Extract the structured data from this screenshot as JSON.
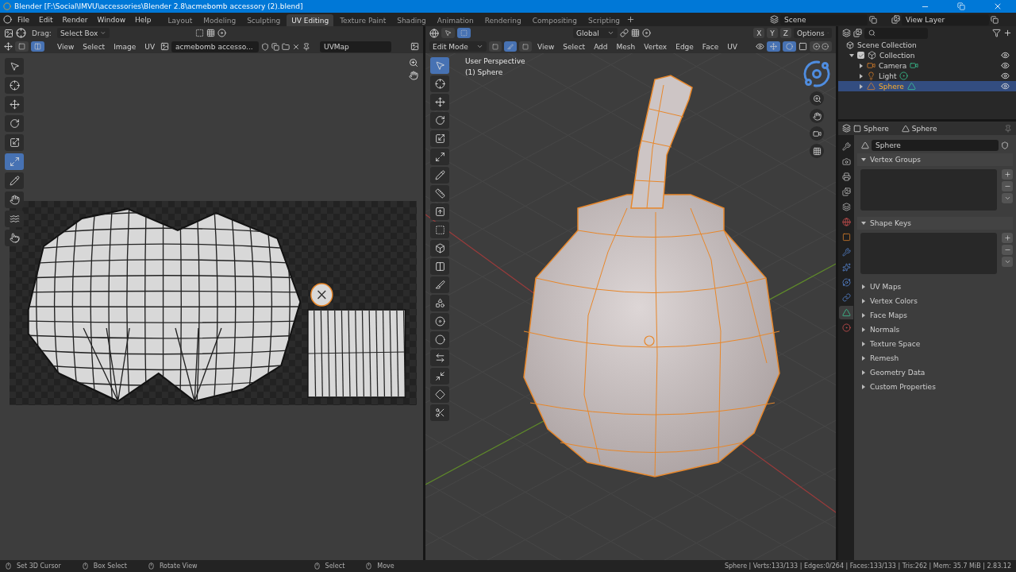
{
  "window": {
    "title": "Blender [F:\\Social\\IMVU\\accessories\\Blender 2.8\\acmebomb accessory (2).blend]"
  },
  "menu": [
    "File",
    "Edit",
    "Render",
    "Window",
    "Help"
  ],
  "workspaces": [
    {
      "label": "Layout",
      "selected": false
    },
    {
      "label": "Modeling",
      "selected": false
    },
    {
      "label": "Sculpting",
      "selected": false
    },
    {
      "label": "UV Editing",
      "selected": true
    },
    {
      "label": "Texture Paint",
      "selected": false
    },
    {
      "label": "Shading",
      "selected": false
    },
    {
      "label": "Animation",
      "selected": false
    },
    {
      "label": "Rendering",
      "selected": false
    },
    {
      "label": "Compositing",
      "selected": false
    },
    {
      "label": "Scripting",
      "selected": false
    }
  ],
  "scene": {
    "scene": "Scene",
    "view_layer": "View Layer"
  },
  "uv_editor": {
    "drag_label": "Drag:",
    "drag_mode": "Select Box",
    "menus": [
      "View",
      "Select",
      "Image",
      "UV"
    ],
    "image_name": "acmebomb accesso...",
    "uv_map": "UVMap",
    "tools": [
      {
        "kind": "select",
        "selected": false
      },
      {
        "kind": "cursor",
        "selected": false
      },
      {
        "kind": "move",
        "selected": false
      },
      {
        "kind": "rotate",
        "selected": false
      },
      {
        "kind": "scale",
        "selected": false
      },
      {
        "kind": "transform",
        "selected": true
      },
      {
        "kind": "annotate",
        "selected": false
      },
      {
        "kind": "grab",
        "selected": false
      },
      {
        "kind": "relax",
        "selected": false
      },
      {
        "kind": "pinch",
        "selected": false
      }
    ]
  },
  "viewport": {
    "orientation": "Global",
    "axes": [
      "X",
      "Y",
      "Z"
    ],
    "options": "Options",
    "mode": "Edit Mode",
    "menus": [
      "View",
      "Select",
      "Add",
      "Mesh",
      "Vertex",
      "Edge",
      "Face",
      "UV"
    ],
    "overlay_lines": [
      "User Perspective",
      "(1) Sphere"
    ],
    "tools": [
      {
        "kind": "select",
        "selected": true
      },
      {
        "kind": "cursor",
        "selected": false
      },
      {
        "kind": "move",
        "selected": false
      },
      {
        "kind": "rotate",
        "selected": false
      },
      {
        "kind": "scale",
        "selected": false
      },
      {
        "kind": "transform",
        "selected": false
      },
      {
        "kind": "annotate",
        "selected": false
      },
      {
        "kind": "measure",
        "selected": false
      },
      {
        "kind": "extrude",
        "selected": false
      },
      {
        "kind": "inset",
        "selected": false
      },
      {
        "kind": "bevel",
        "selected": false
      },
      {
        "kind": "loopcut",
        "selected": false
      },
      {
        "kind": "knife",
        "selected": false
      },
      {
        "kind": "polybuild",
        "selected": false
      },
      {
        "kind": "spin",
        "selected": false
      },
      {
        "kind": "smooth",
        "selected": false
      },
      {
        "kind": "edgeslide",
        "selected": false
      },
      {
        "kind": "shrink",
        "selected": false
      },
      {
        "kind": "shear",
        "selected": false
      },
      {
        "kind": "rip",
        "selected": false
      }
    ]
  },
  "outliner": {
    "root": "Scene Collection",
    "items": [
      {
        "label": "Collection",
        "kind": "collection",
        "checked": true,
        "expanded": true,
        "selected": false,
        "children": [
          {
            "label": "Camera",
            "kind": "camera",
            "selected": false
          },
          {
            "label": "Light",
            "kind": "light",
            "selected": false
          },
          {
            "label": "Sphere",
            "kind": "mesh",
            "selected": true
          }
        ]
      }
    ]
  },
  "properties": {
    "object": "Sphere",
    "data": "Sphere",
    "name": "Sphere",
    "tabs": [
      {
        "kind": "tool",
        "selected": false
      },
      {
        "kind": "render",
        "selected": false
      },
      {
        "kind": "output",
        "selected": false
      },
      {
        "kind": "view_layer",
        "selected": false
      },
      {
        "kind": "scene",
        "selected": false
      },
      {
        "kind": "world",
        "selected": false
      },
      {
        "kind": "object",
        "selected": false
      },
      {
        "kind": "modifiers",
        "selected": false
      },
      {
        "kind": "particles",
        "selected": false
      },
      {
        "kind": "physics",
        "selected": false
      },
      {
        "kind": "constraints",
        "selected": false
      },
      {
        "kind": "data",
        "selected": true
      },
      {
        "kind": "material",
        "selected": false
      }
    ],
    "panels": [
      {
        "label": "Vertex Groups",
        "expanded": true
      },
      {
        "label": "Shape Keys",
        "expanded": true
      },
      {
        "label": "UV Maps",
        "expanded": false
      },
      {
        "label": "Vertex Colors",
        "expanded": false
      },
      {
        "label": "Face Maps",
        "expanded": false
      },
      {
        "label": "Normals",
        "expanded": false
      },
      {
        "label": "Texture Space",
        "expanded": false
      },
      {
        "label": "Remesh",
        "expanded": false
      },
      {
        "label": "Geometry Data",
        "expanded": false
      },
      {
        "label": "Custom Properties",
        "expanded": false
      }
    ]
  },
  "status_bar": {
    "hints": [
      "Set 3D Cursor",
      "Box Select",
      "Rotate View",
      "Select",
      "Move"
    ],
    "stats": "Sphere | Verts:133/133 | Edges:0/264 | Faces:133/133 | Tris:262 | Mem: 35.7 MiB | 2.83.12"
  }
}
